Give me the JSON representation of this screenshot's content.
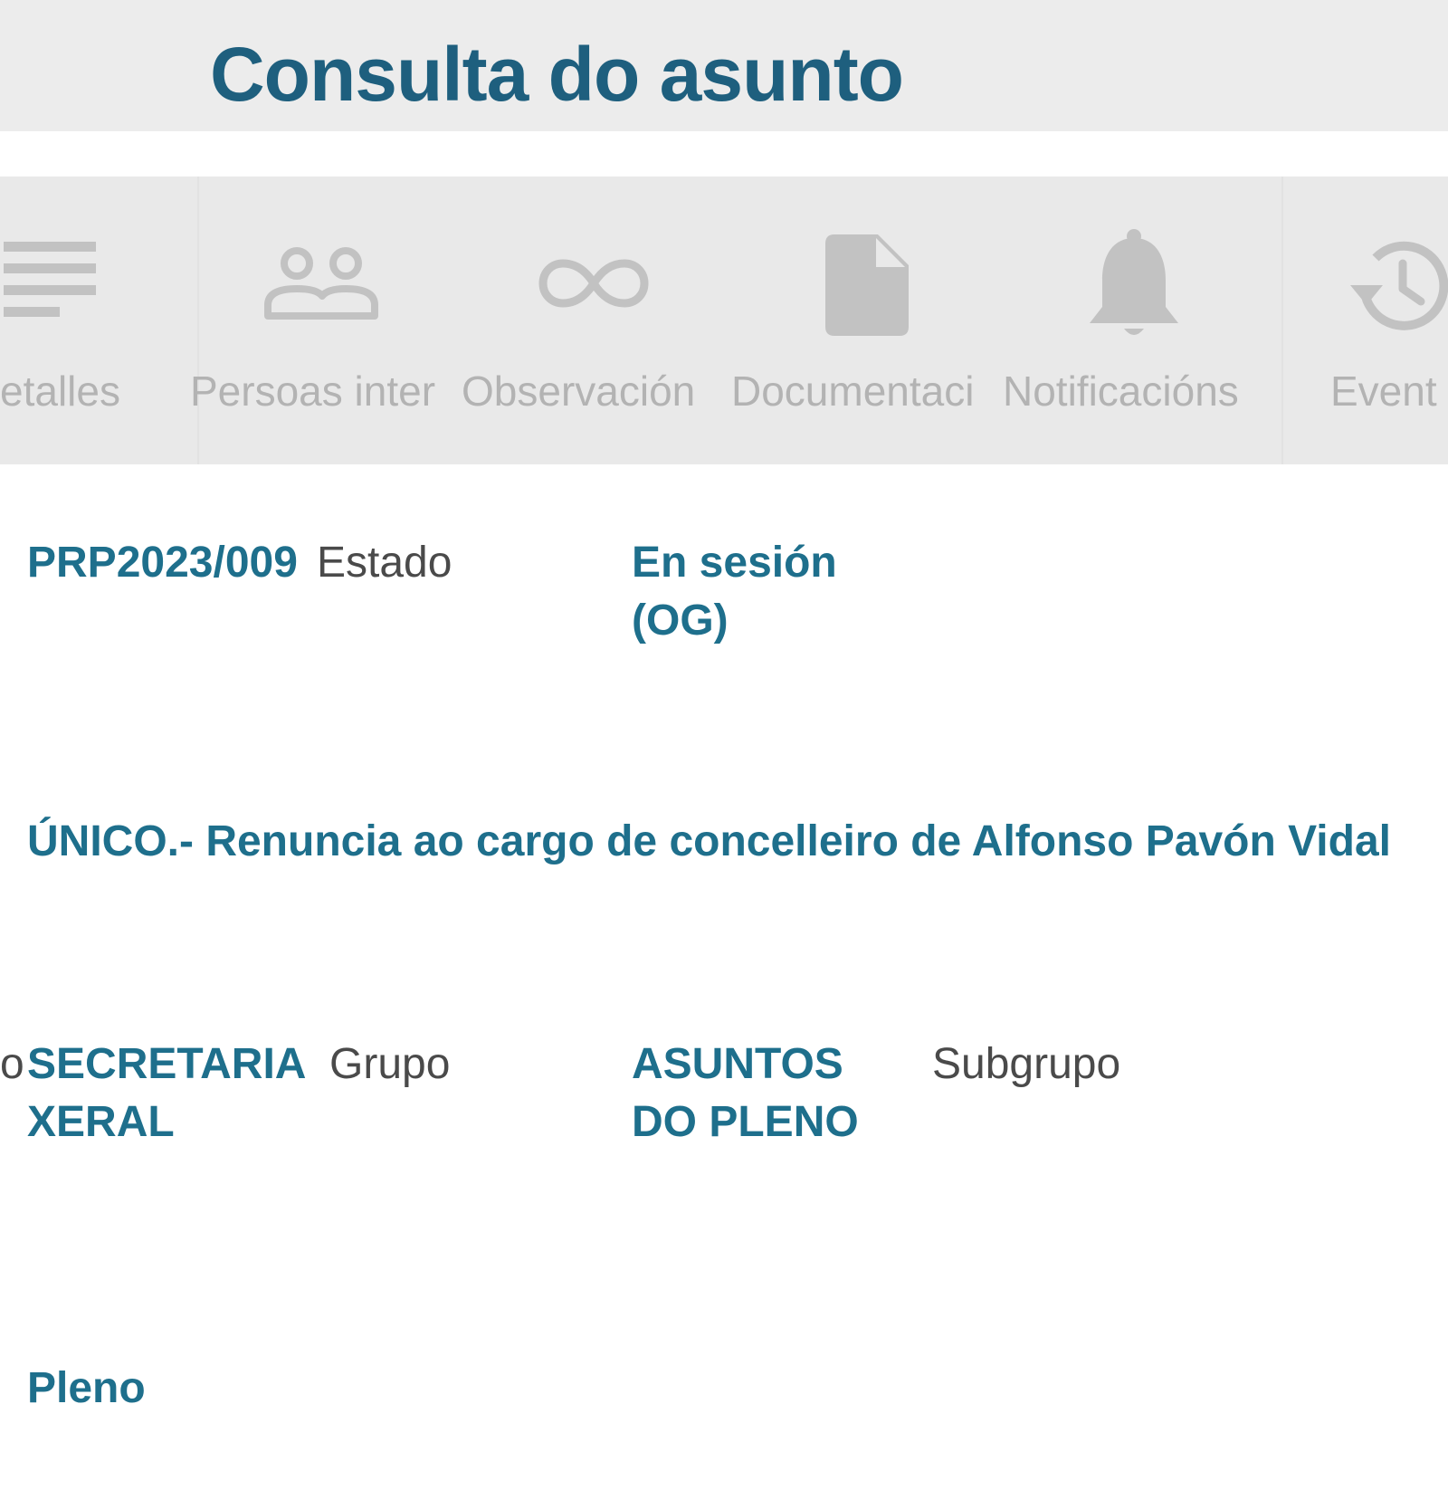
{
  "header": {
    "title": "Consulta do asunto"
  },
  "tabs": [
    {
      "label": "etalles",
      "icon": "details-lines-icon"
    },
    {
      "label": "Persoas inter",
      "icon": "people-icon"
    },
    {
      "label": "Observación",
      "icon": "link-icon"
    },
    {
      "label": "Documentaci",
      "icon": "document-icon"
    },
    {
      "label": "Notificacións",
      "icon": "bell-icon"
    },
    {
      "label": "Event",
      "icon": "history-icon"
    }
  ],
  "details": {
    "code": "PRP2023/009",
    "state_label": "Estado",
    "state_value_line1": "En sesión",
    "state_value_line2": "(OG)",
    "subject": "ÚNICO.- Renuncia ao cargo de concelleiro de Alfonso Pavón Vidal",
    "row3_lead": "o",
    "department_line1": "SECRETARIA",
    "department_line2": "XERAL",
    "group_label": "Grupo",
    "group_value_line1": "ASUNTOS",
    "group_value_line2": "DO PLENO",
    "subgroup_label": "Subgrupo",
    "organ": "Pleno"
  },
  "colors": {
    "title": "#1e5f7e",
    "value_text": "#1e6f8c",
    "label_text": "#4a4a4a",
    "tab_inactive": "#b3b3b3",
    "header_bg": "#ececec",
    "tabbar_bg": "#e9e9e9"
  }
}
